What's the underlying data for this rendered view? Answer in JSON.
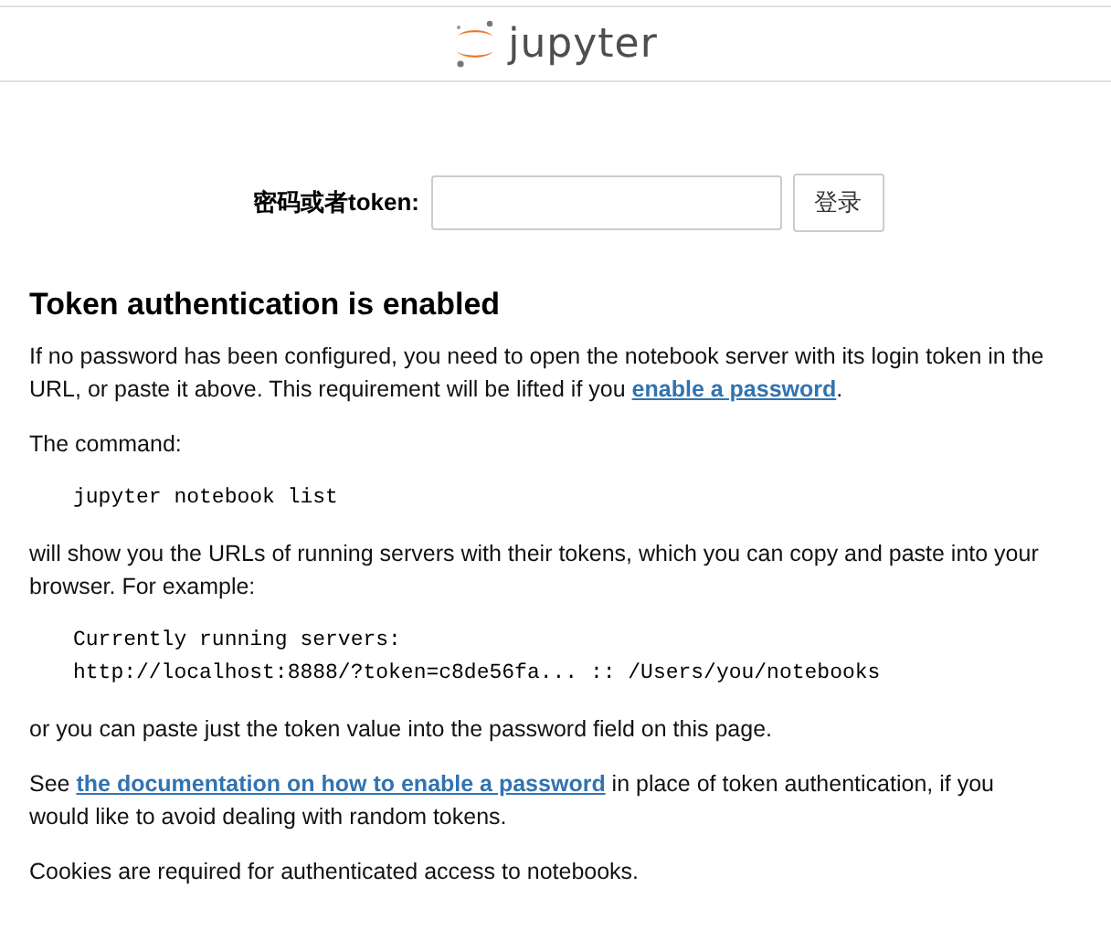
{
  "header": {
    "logo_text": "jupyter"
  },
  "login": {
    "label": "密码或者token:",
    "button": "登录"
  },
  "heading": "Token authentication is enabled",
  "blocks": [
    {
      "kind": "para",
      "parts": [
        {
          "text": "If no password has been configured, you need to open the notebook server with its login token in the URL, or paste it above. This requirement will be lifted if you "
        },
        {
          "link": "enable a password"
        },
        {
          "text": "."
        }
      ]
    },
    {
      "kind": "para",
      "parts": [
        {
          "text": "The command:"
        }
      ]
    },
    {
      "kind": "code",
      "lines": [
        "jupyter notebook list"
      ]
    },
    {
      "kind": "para",
      "parts": [
        {
          "text": "will show you the URLs of running servers with their tokens, which you can copy and paste into your browser. For example:"
        }
      ]
    },
    {
      "kind": "code",
      "lines": [
        "Currently running servers:",
        "http://localhost:8888/?token=c8de56fa... :: /Users/you/notebooks"
      ]
    },
    {
      "kind": "para",
      "parts": [
        {
          "text": "or you can paste just the token value into the password field on this page."
        }
      ]
    },
    {
      "kind": "para",
      "parts": [
        {
          "text": "See "
        },
        {
          "link": "the documentation on how to enable a password"
        },
        {
          "text": " in place of token authentication, if you would like to avoid dealing with random tokens."
        }
      ]
    },
    {
      "kind": "para",
      "parts": [
        {
          "text": "Cookies are required for authenticated access to notebooks."
        }
      ]
    }
  ]
}
